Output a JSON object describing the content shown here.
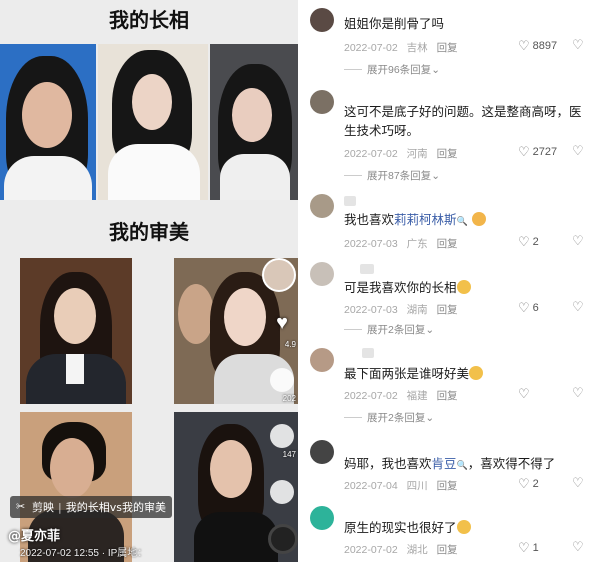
{
  "left": {
    "heading_top": "我的长相",
    "heading_bottom": "我的审美",
    "side_counts": [
      "4.9",
      "202",
      "147"
    ],
    "capcut": {
      "app": "剪映",
      "separator": "|",
      "title": "我的长相vs我的审美"
    },
    "author": "@夏亦菲",
    "meta": "2022-07-02 12:55 · IP属地："
  },
  "comments": [
    {
      "text": "姐姐你是削骨了吗",
      "date": "2022-07-02",
      "location": "吉林",
      "reply": "回复",
      "likes": "8897",
      "expand": "展开96条回复"
    },
    {
      "text": "这可不是底子好的问题。这是整商高呀，医生技术巧呀。",
      "date": "2022-07-02",
      "location": "河南",
      "reply": "回复",
      "likes": "2727",
      "expand": "展开87条回复"
    },
    {
      "text_before": "我也喜欢",
      "text_highlight": "莉莉柯林斯",
      "date": "2022-07-03",
      "location": "广东",
      "reply": "回复",
      "likes": "2",
      "expand": ""
    },
    {
      "text": "可是我喜欢你的长相",
      "date": "2022-07-03",
      "location": "湖南",
      "reply": "回复",
      "likes": "6",
      "expand": "展开2条回复"
    },
    {
      "text": "最下面两张是谁呀好美",
      "date": "2022-07-02",
      "location": "福建",
      "reply": "回复",
      "likes": "",
      "expand": "展开2条回复"
    },
    {
      "text_before": "妈耶，我也喜欢",
      "text_highlight": "肯豆",
      "text_after": "，喜欢得不得了",
      "date": "2022-07-04",
      "location": "四川",
      "reply": "回复",
      "likes": "2",
      "expand": ""
    },
    {
      "text": "原生的现实也很好了",
      "date": "2022-07-02",
      "location": "湖北",
      "reply": "回复",
      "likes": "1",
      "expand": ""
    }
  ],
  "icons": {
    "like": "heart-outline-icon",
    "dislike": "broken-heart-icon",
    "expand": "chevron-down-icon"
  },
  "colors": {
    "highlight": "#3b5ea8",
    "meta": "#a7a7a7"
  }
}
